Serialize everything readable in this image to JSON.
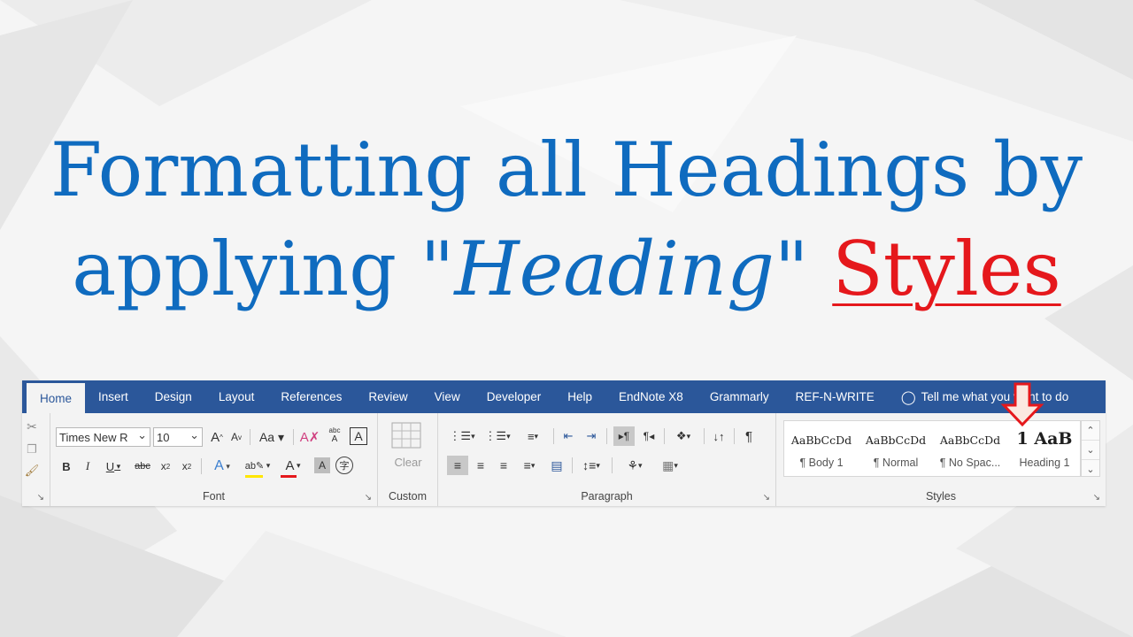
{
  "title": {
    "line1": "Formatting all Headings by",
    "line2_pre": "applying \"",
    "line2_em": "Heading",
    "line2_post": "\" ",
    "line2_red": "Styles"
  },
  "colors": {
    "title_blue": "#0f6bbf",
    "title_red": "#e5181c",
    "ribbon_blue": "#2b579a",
    "arrow_red": "#e5181c"
  },
  "tabs": [
    {
      "label": "Home"
    },
    {
      "label": "Insert"
    },
    {
      "label": "Design"
    },
    {
      "label": "Layout"
    },
    {
      "label": "References"
    },
    {
      "label": "Review"
    },
    {
      "label": "View"
    },
    {
      "label": "Developer"
    },
    {
      "label": "Help"
    },
    {
      "label": "EndNote X8"
    },
    {
      "label": "Grammarly"
    },
    {
      "label": "REF-N-WRITE"
    },
    {
      "label": "Tell me what you want to do"
    }
  ],
  "font": {
    "name": "Times New R",
    "size": "10",
    "group_label": "Font"
  },
  "custom": {
    "clear_label": "Clear",
    "group_label": "Custom"
  },
  "paragraph": {
    "group_label": "Paragraph"
  },
  "styles": {
    "group_label": "Styles",
    "items": [
      {
        "sample": "AaBbCcDd",
        "name": "¶ Body 1"
      },
      {
        "sample": "AaBbCcDd",
        "name": "¶ Normal"
      },
      {
        "sample": "AaBbCcDd",
        "name": "¶ No Spac..."
      },
      {
        "sample": "1  AaB",
        "name": "Heading 1"
      }
    ]
  },
  "icons": {
    "font": [
      "bold-icon",
      "italic-icon",
      "underline-icon",
      "strikethrough-icon",
      "subscript-icon",
      "superscript-icon",
      "text-effects-icon",
      "highlight-icon",
      "font-color-icon",
      "character-shading-icon",
      "enclose-characters-icon"
    ]
  }
}
